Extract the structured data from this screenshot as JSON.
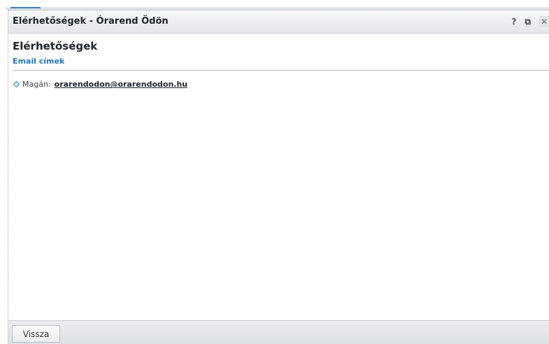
{
  "window": {
    "title": "Elérhetőségek - Órarend Ödön",
    "help_icon": "?",
    "popout_icon": "⧉",
    "close_icon": "✕"
  },
  "main": {
    "heading": "Elérhetőségek",
    "section_title": "Email címek",
    "emails": [
      {
        "label": "Magán:",
        "address": "orarendodon@orarendodon.hu"
      }
    ]
  },
  "footer": {
    "back_label": "Vissza"
  },
  "colors": {
    "section_title": "#2a76b9",
    "bullet": "#4d8fc9"
  }
}
